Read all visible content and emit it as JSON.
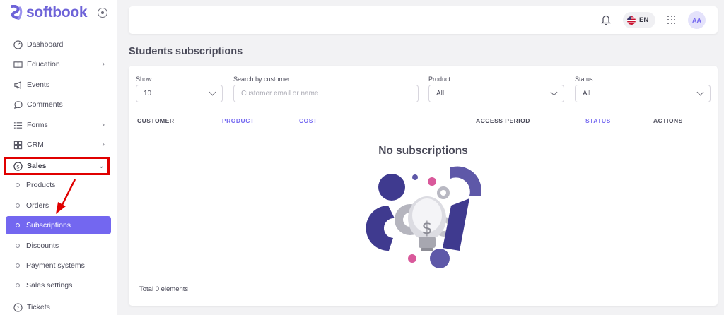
{
  "brand": {
    "name": "softbook"
  },
  "sidebar": {
    "items": [
      {
        "label": "Dashboard",
        "icon": "dashboard-icon"
      },
      {
        "label": "Education",
        "icon": "book-icon"
      },
      {
        "label": "Events",
        "icon": "megaphone-icon"
      },
      {
        "label": "Comments",
        "icon": "comment-icon"
      },
      {
        "label": "Forms",
        "icon": "list-icon"
      },
      {
        "label": "CRM",
        "icon": "grid-icon"
      },
      {
        "label": "Sales",
        "icon": "dollar-circle-icon"
      },
      {
        "label": "Tickets",
        "icon": "help-circle-icon"
      }
    ],
    "sales_subitems": [
      {
        "label": "Products"
      },
      {
        "label": "Orders"
      },
      {
        "label": "Subscriptions"
      },
      {
        "label": "Discounts"
      },
      {
        "label": "Payment systems"
      },
      {
        "label": "Sales settings"
      }
    ]
  },
  "topbar": {
    "lang": "EN",
    "avatar": "AA"
  },
  "page": {
    "title": "Students subscriptions"
  },
  "filters": {
    "show": {
      "label": "Show",
      "value": "10"
    },
    "search": {
      "label": "Search by customer",
      "placeholder": "Customer email or name"
    },
    "product": {
      "label": "Product",
      "value": "All"
    },
    "status": {
      "label": "Status",
      "value": "All"
    }
  },
  "table": {
    "headers": [
      "CUSTOMER",
      "PRODUCT",
      "COST",
      "ACCESS PERIOD",
      "STATUS",
      "ACTIONS"
    ],
    "empty_text": "No subscriptions",
    "total": "Total 0 elements"
  },
  "colors": {
    "accent": "#7367f0",
    "highlight": "#e00000",
    "illustration_dark": "#3f3a8f",
    "illustration_pink": "#d9599b"
  }
}
